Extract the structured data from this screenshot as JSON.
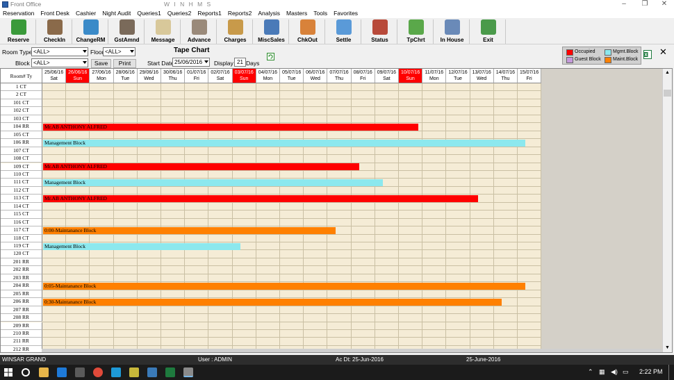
{
  "window": {
    "title": "Front Office",
    "center_title": "W I N H M S",
    "minimize": "–",
    "maximize": "❐",
    "close": "✕"
  },
  "menu": [
    "Reservation",
    "Front Desk",
    "Cashier",
    "Night Audit",
    "Queries1",
    "Queries2",
    "Reports1",
    "Reports2",
    "Analysis",
    "Masters",
    "Tools",
    "Favorites"
  ],
  "toolbar": [
    {
      "label": "Reserve",
      "icon": "reserve-icon",
      "color": "#3a9a3a"
    },
    {
      "label": "CheckIn",
      "icon": "checkin-icon",
      "color": "#8a6a4a"
    },
    {
      "label": "ChangeRM",
      "icon": "change-room-icon",
      "color": "#3a8ac8"
    },
    {
      "label": "GstAmnd",
      "icon": "guest-amend-icon",
      "color": "#7a6a5a"
    },
    {
      "label": "Message",
      "icon": "message-icon",
      "color": "#d8c89a"
    },
    {
      "label": "Advance",
      "icon": "advance-icon",
      "color": "#9a8a7a"
    },
    {
      "label": "Charges",
      "icon": "charges-icon",
      "color": "#c89a4a"
    },
    {
      "label": "MiscSales",
      "icon": "misc-sales-icon",
      "color": "#4a7ab8"
    },
    {
      "label": "ChkOut",
      "icon": "checkout-icon",
      "color": "#d8823a"
    },
    {
      "label": "Settle",
      "icon": "settle-icon",
      "color": "#5a9ad8"
    },
    {
      "label": "Status",
      "icon": "calendar-icon",
      "color": "#b84a3a"
    },
    {
      "label": "TpChrt",
      "icon": "tape-chart-icon",
      "color": "#5aa84a"
    },
    {
      "label": "In House",
      "icon": "in-house-icon",
      "color": "#6a8ab8"
    },
    {
      "label": "Exit",
      "icon": "exit-icon",
      "color": "#4a9a4a"
    }
  ],
  "filters": {
    "room_type_label": "Room Type",
    "room_type_value": "<ALL>",
    "floor_label": "Floor",
    "floor_value": "<ALL>",
    "block_label": "Block",
    "block_value": "<ALL>",
    "save_label": "Save",
    "print_label": "Print",
    "chart_title": "Tape Chart",
    "start_date_label": "Start Date",
    "start_date_value": "25/06/2016",
    "display_label": "Display",
    "display_value": "21",
    "days_label": "Days"
  },
  "legend": [
    {
      "label": "Occupied",
      "color": "#ff0000"
    },
    {
      "label": "Mgmt.Block",
      "color": "#8ce8ee"
    },
    {
      "label": "Guest Block",
      "color": "#c59adb"
    },
    {
      "label": "Maint.Block",
      "color": "#ff8000"
    }
  ],
  "grid": {
    "room_header": "Room# Ty",
    "dates": [
      {
        "date": "25/06/16",
        "day": "Sat",
        "red": false
      },
      {
        "date": "26/06/16",
        "day": "Sun",
        "red": true
      },
      {
        "date": "27/06/16",
        "day": "Mon",
        "red": false
      },
      {
        "date": "28/06/16",
        "day": "Tue",
        "red": false
      },
      {
        "date": "29/06/16",
        "day": "Wed",
        "red": false
      },
      {
        "date": "30/06/16",
        "day": "Thu",
        "red": false
      },
      {
        "date": "01/07/16",
        "day": "Fri",
        "red": false
      },
      {
        "date": "02/07/16",
        "day": "Sat",
        "red": false
      },
      {
        "date": "03/07/16",
        "day": "Sun",
        "red": true
      },
      {
        "date": "04/07/16",
        "day": "Mon",
        "red": false
      },
      {
        "date": "05/07/16",
        "day": "Tue",
        "red": false
      },
      {
        "date": "06/07/16",
        "day": "Wed",
        "red": false
      },
      {
        "date": "07/07/16",
        "day": "Thu",
        "red": false
      },
      {
        "date": "08/07/16",
        "day": "Fri",
        "red": false
      },
      {
        "date": "09/07/16",
        "day": "Sat",
        "red": false
      },
      {
        "date": "10/07/16",
        "day": "Sun",
        "red": true
      },
      {
        "date": "11/07/16",
        "day": "Mon",
        "red": false
      },
      {
        "date": "12/07/16",
        "day": "Tue",
        "red": false
      },
      {
        "date": "13/07/16",
        "day": "Wed",
        "red": false
      },
      {
        "date": "14/07/16",
        "day": "Thu",
        "red": false
      },
      {
        "date": "15/07/16",
        "day": "Fri",
        "red": false
      }
    ],
    "rooms": [
      "1 CT",
      "2 CT",
      "101 CT",
      "102 CT",
      "103 CT",
      "104 RR",
      "105 CT",
      "106 RR",
      "107 CT",
      "108 CT",
      "109 CT",
      "110 CT",
      "111 CT",
      "112 CT",
      "113 CT",
      "114 CT",
      "115 CT",
      "116 CT",
      "117 CT",
      "118 CT",
      "119 CT",
      "120 CT",
      "201 RR",
      "202 RR",
      "203 RR",
      "204 RR",
      "205 RR",
      "206 RR",
      "207 RR",
      "208 RR",
      "209 RR",
      "210 RR",
      "211 RR",
      "212 RR"
    ],
    "bookings": [
      {
        "row": 5,
        "label": "Mr.AB ANTHONY ALFRED",
        "type": "occupied",
        "days": 15.8
      },
      {
        "row": 7,
        "label": "Management Block",
        "type": "mgmt",
        "days": 20.3
      },
      {
        "row": 10,
        "label": "Mr.AB ANTHONY ALFRED",
        "type": "occupied",
        "days": 13.3
      },
      {
        "row": 12,
        "label": "Management Block",
        "type": "mgmt",
        "days": 14.3
      },
      {
        "row": 14,
        "label": "Mr.AB ANTHONY ALFRED",
        "type": "occupied",
        "days": 18.3
      },
      {
        "row": 18,
        "label": "0:00-Maintanance Block",
        "type": "maint",
        "days": 12.3
      },
      {
        "row": 20,
        "label": "Management Block",
        "type": "mgmt",
        "days": 8.3
      },
      {
        "row": 25,
        "label": "0:05-Maintanance Block",
        "type": "maint",
        "days": 20.3
      },
      {
        "row": 27,
        "label": "0:30-Maintanance Block",
        "type": "maint",
        "days": 19.3
      }
    ],
    "type_colors": {
      "occupied": "#ff0000",
      "mgmt": "#8ce8ee",
      "maint": "#ff8000"
    }
  },
  "status": {
    "hotel": "WINSAR GRAND",
    "user": "User :  ADMIN",
    "acct_date": "Ac Dt: 25-Jun-2016",
    "date": "25-June-2016"
  },
  "taskbar": {
    "time": "2:22 PM"
  }
}
